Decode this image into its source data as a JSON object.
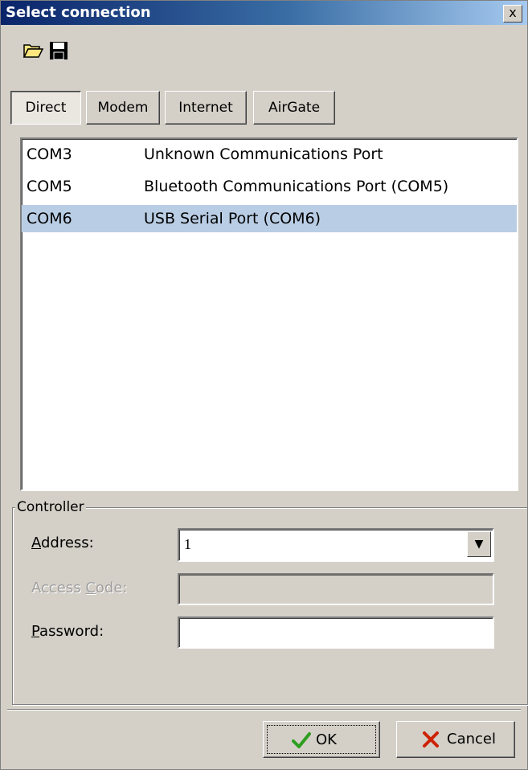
{
  "window": {
    "title": "Select connection",
    "close_label": "x"
  },
  "toolbar": {
    "open_icon": "folder-open-icon",
    "save_icon": "floppy-save-icon"
  },
  "tabs": [
    {
      "label": "Direct",
      "active": true
    },
    {
      "label": "Modem",
      "active": false
    },
    {
      "label": "Internet",
      "active": false
    },
    {
      "label": "AirGate",
      "active": false
    }
  ],
  "ports": [
    {
      "port": "COM3",
      "description": "Unknown Communications Port",
      "selected": false
    },
    {
      "port": "COM5",
      "description": "Bluetooth Communications Port (COM5)",
      "selected": false
    },
    {
      "port": "COM6",
      "description": "USB Serial Port (COM6)",
      "selected": true
    }
  ],
  "controller": {
    "group_label": "Controller",
    "address_label": "Address:",
    "address_value": "1",
    "access_code_label": "Access Code:",
    "access_code_value": "",
    "password_label": "Password:",
    "password_value": ""
  },
  "buttons": {
    "ok_label": "OK",
    "cancel_label": "Cancel"
  },
  "colors": {
    "title_bar": "#0a246a",
    "selection": "#b9cde5",
    "dialog_bg": "#d4d0c8",
    "ok_check": "#2e9e1e",
    "cancel_x": "#cc2200"
  }
}
